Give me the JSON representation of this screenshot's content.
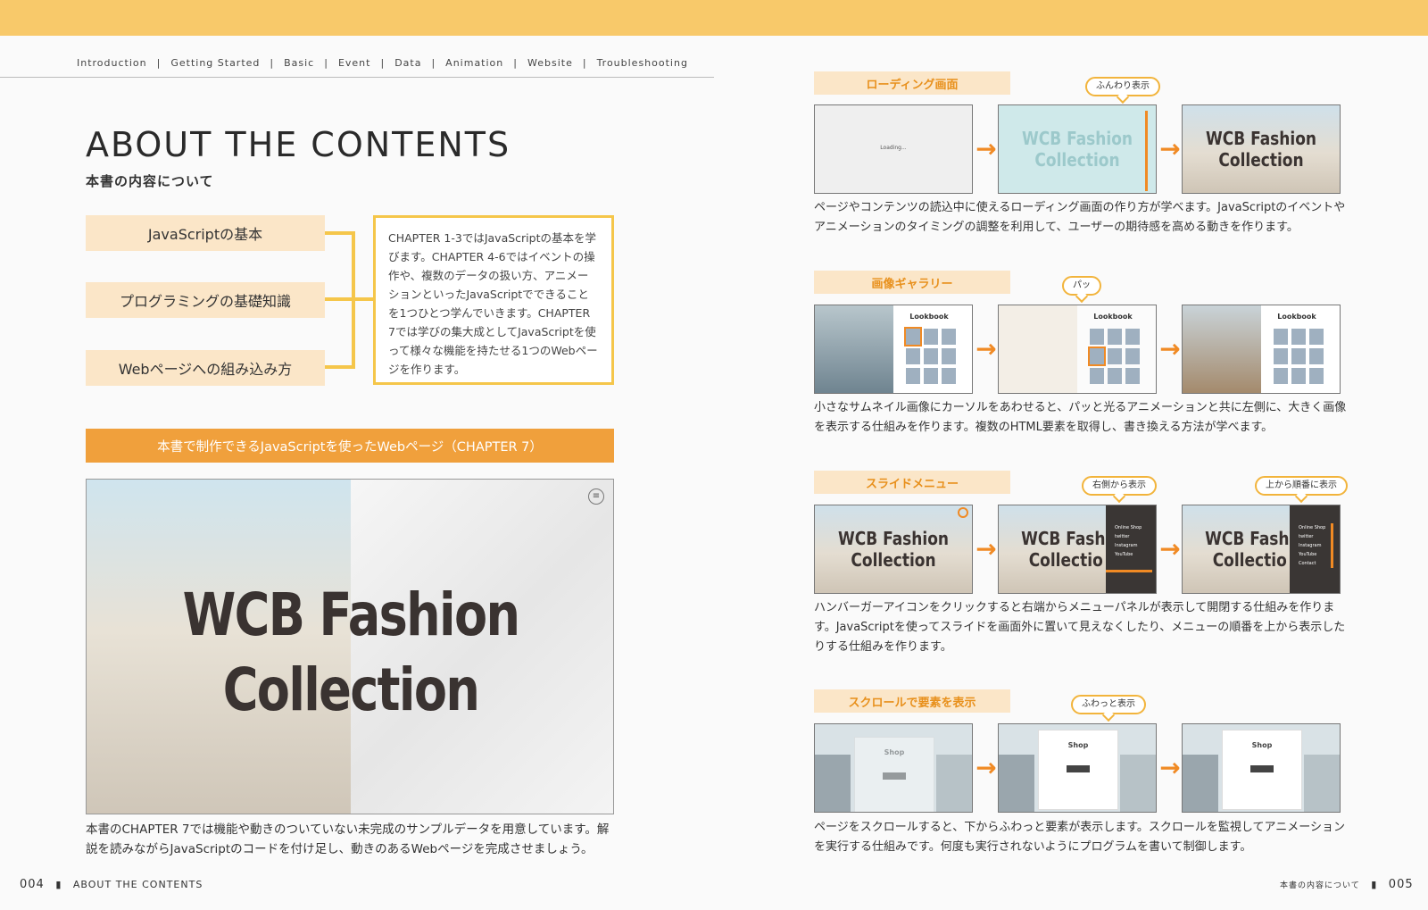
{
  "header": {
    "nav": [
      "Introduction",
      "Getting Started",
      "Basic",
      "Event",
      "Data",
      "Animation",
      "Website",
      "Troubleshooting"
    ]
  },
  "left": {
    "title": "ABOUT THE CONTENTS",
    "subtitle": "本書の内容について",
    "pills": [
      "JavaScriptの基本",
      "プログラミングの基礎知識",
      "Webページへの組み込み方"
    ],
    "description": "CHAPTER 1-3ではJavaScriptの基本を学びます。CHAPTER 4-6ではイベントの操作や、複数のデータの扱い方、アニメーションといったJavaScriptでできることを1つひとつ学んでいきます。CHAPTER 7では学びの集大成としてJavaScriptを使って様々な機能を持たせる1つのWebページを作ります。",
    "banner": "本書で制作できるJavaScriptを使ったWebページ（CHAPTER 7）",
    "hero": {
      "line1": "WCB Fashion",
      "line2": "Collection",
      "menu_icon": "≡"
    },
    "caption": "本書のCHAPTER 7では機能や動きのついていない未完成のサンプルデータを用意しています。解説を読みながらJavaScriptのコードを付け足し、動きのあるWebページを完成させましょう。",
    "footer": {
      "page": "004",
      "label": "ABOUT THE CONTENTS"
    }
  },
  "right": {
    "sections": [
      {
        "label": "ローディング画面",
        "bubble": "ふんわり表示",
        "loading_text": "Loading...",
        "caption": "ページやコンテンツの読込中に使えるローディング画面の作り方が学べます。JavaScriptのイベントやアニメーションのタイミングの調整を利用して、ユーザーの期待感を高める動きを作ります。"
      },
      {
        "label": "画像ギャラリー",
        "bubble": "パッ",
        "lookbook": "Lookbook",
        "caption": "小さなサムネイル画像にカーソルをあわせると、パッと光るアニメーションと共に左側に、大きく画像を表示する仕組みを作ります。複数のHTML要素を取得し、書き換える方法が学べます。"
      },
      {
        "label": "スライドメニュー",
        "bubble": "右側から表示",
        "bubble2": "上から順番に表示",
        "menu_items": [
          "Online Shop",
          "twitter",
          "Instagram",
          "YouTube",
          "Contact"
        ],
        "caption": "ハンバーガーアイコンをクリックすると右端からメニューパネルが表示して開閉する仕組みを作ります。JavaScriptを使ってスライドを画面外に置いて見えなくしたり、メニューの順番を上から表示したりする仕組みを作ります。"
      },
      {
        "label": "スクロールで要素を表示",
        "bubble": "ふわっと表示",
        "shop": "Shop",
        "caption": "ページをスクロールすると、下からふわっと要素が表示します。スクロールを監視してアニメーションを実行する仕組みです。何度も実行されないようにプログラムを書いて制御します。"
      }
    ],
    "footer": {
      "label": "本書の内容について",
      "page": "005"
    }
  },
  "colors": {
    "accent_orange": "#f08a24",
    "accent_yellow": "#f5c64a",
    "top_bar": "#f8c96a",
    "pill_bg": "#fbe6c8"
  }
}
